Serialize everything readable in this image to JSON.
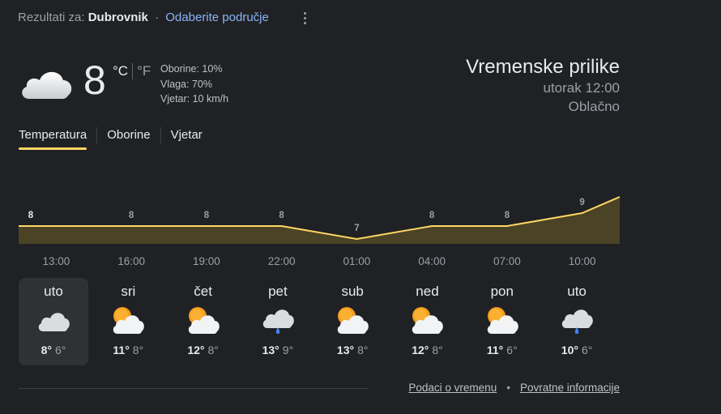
{
  "header": {
    "results_for": "Rezultati za:",
    "location": "Dubrovnik",
    "separator": "·",
    "choose_area": "Odaberite područje",
    "more_icon": "more-vert-icon"
  },
  "current": {
    "icon": "cloudy-icon",
    "temperature": "8",
    "unit_c": "°C",
    "unit_f": "°F",
    "precipitation": "Oborine: 10%",
    "humidity": "Vlaga: 70%",
    "wind": "Vjetar: 10 km/h"
  },
  "summary": {
    "title": "Vremenske prilike",
    "day_time": "utorak 12:00",
    "condition": "Oblačno"
  },
  "tabs": [
    {
      "label": "Temperatura",
      "active": true
    },
    {
      "label": "Oborine",
      "active": false
    },
    {
      "label": "Vjetar",
      "active": false
    }
  ],
  "chart_data": {
    "type": "area",
    "x": [
      "13:00",
      "16:00",
      "19:00",
      "22:00",
      "01:00",
      "04:00",
      "07:00",
      "10:00"
    ],
    "values": [
      8,
      8,
      8,
      8,
      7,
      8,
      8,
      9
    ],
    "labels": [
      "8",
      "8",
      "8",
      "8",
      "7",
      "8",
      "8",
      "9"
    ],
    "color": "#fdd663",
    "fill": "#4a4326"
  },
  "days": [
    {
      "name": "uto",
      "icon": "cloudy-icon",
      "high": "8°",
      "low": "6°",
      "selected": true
    },
    {
      "name": "sri",
      "icon": "partly-cloudy-icon",
      "high": "11°",
      "low": "8°",
      "selected": false
    },
    {
      "name": "čet",
      "icon": "partly-cloudy-icon",
      "high": "12°",
      "low": "8°",
      "selected": false
    },
    {
      "name": "pet",
      "icon": "rain-cloud-icon",
      "high": "13°",
      "low": "9°",
      "selected": false
    },
    {
      "name": "sub",
      "icon": "partly-cloudy-icon",
      "high": "13°",
      "low": "8°",
      "selected": false
    },
    {
      "name": "ned",
      "icon": "partly-cloudy-icon",
      "high": "12°",
      "low": "8°",
      "selected": false
    },
    {
      "name": "pon",
      "icon": "partly-cloudy-icon",
      "high": "11°",
      "low": "6°",
      "selected": false
    },
    {
      "name": "uto",
      "icon": "rain-cloud-icon",
      "high": "10°",
      "low": "6°",
      "selected": false
    }
  ],
  "footer": {
    "weather_data": "Podaci o vremenu",
    "dot": "•",
    "feedback": "Povratne informacije"
  }
}
